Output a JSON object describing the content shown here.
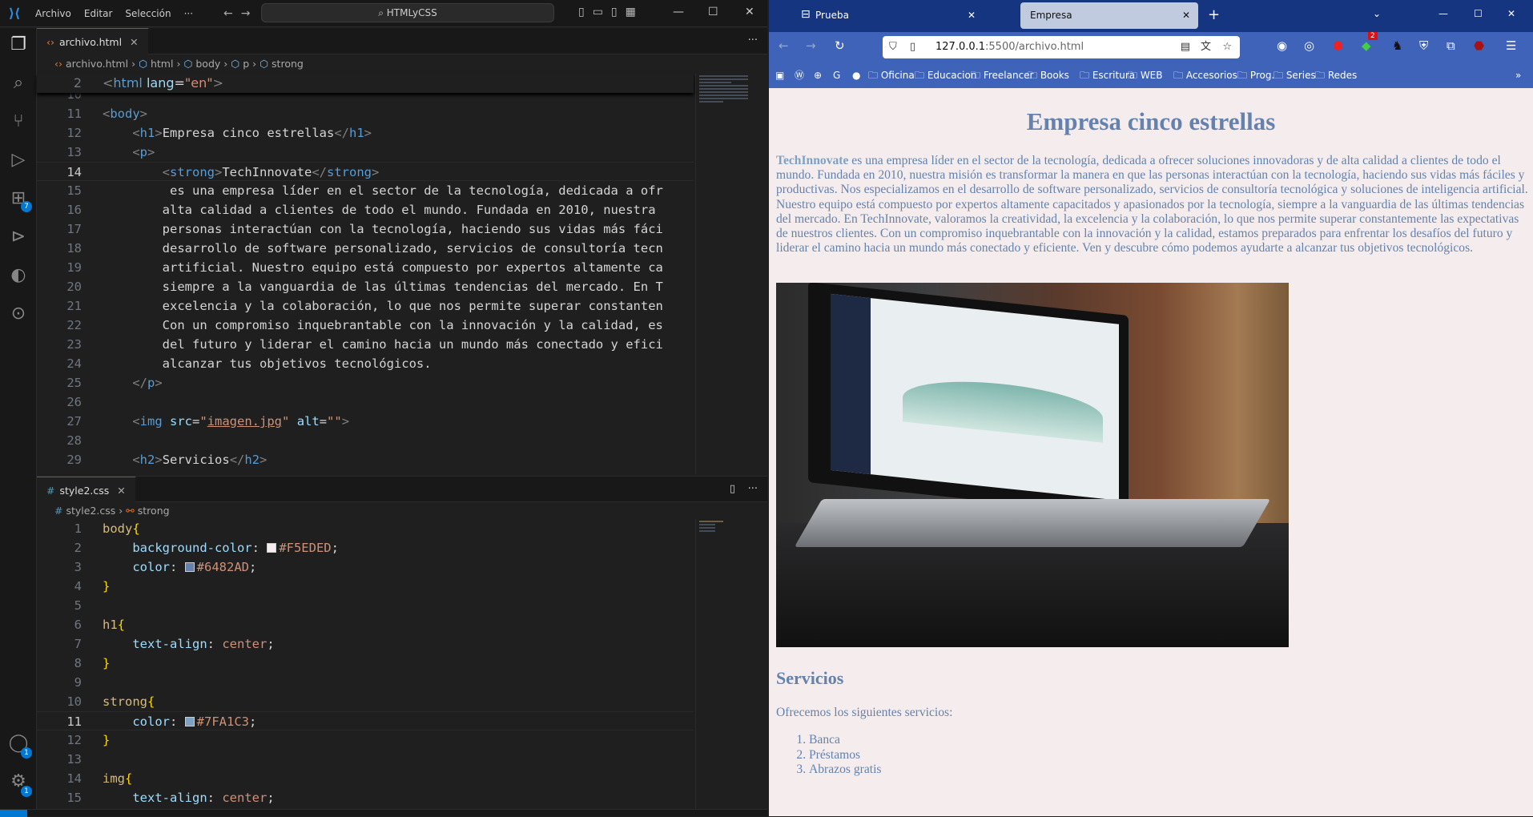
{
  "vscode": {
    "menu": [
      "Archivo",
      "Editar",
      "Selección",
      "···"
    ],
    "search": "HTMLyCSS",
    "activity_badges": {
      "extensions": "7",
      "accounts": "1",
      "settings": "1"
    },
    "html_editor": {
      "tab": "archivo.html",
      "breadcrumb": [
        "archivo.html",
        "html",
        "body",
        "p",
        "strong"
      ],
      "sticky": {
        "n": "2",
        "tokens": [
          [
            "tag",
            "<"
          ],
          [
            "tn",
            "html"
          ],
          [
            "at",
            " lang"
          ],
          [
            "pl",
            "="
          ],
          [
            "st",
            "\"en\""
          ],
          [
            "tag",
            ">"
          ]
        ]
      },
      "lines": [
        {
          "n": "10",
          "tokens": []
        },
        {
          "n": "11",
          "tokens": [
            [
              "tag",
              "<"
            ],
            [
              "tn",
              "body"
            ],
            [
              "tag",
              ">"
            ]
          ]
        },
        {
          "n": "12",
          "tokens": [
            [
              "pl",
              "    "
            ],
            [
              "tag",
              "<"
            ],
            [
              "tn",
              "h1"
            ],
            [
              "tag",
              ">"
            ],
            [
              "pl",
              "Empresa cinco estrellas"
            ],
            [
              "tag",
              "</"
            ],
            [
              "tn",
              "h1"
            ],
            [
              "tag",
              ">"
            ]
          ]
        },
        {
          "n": "13",
          "tokens": [
            [
              "pl",
              "    "
            ],
            [
              "tag",
              "<"
            ],
            [
              "tn",
              "p"
            ],
            [
              "tag",
              ">"
            ]
          ]
        },
        {
          "n": "14",
          "tokens": [
            [
              "pl",
              "        "
            ],
            [
              "tag",
              "<"
            ],
            [
              "tn",
              "strong"
            ],
            [
              "tag",
              ">"
            ],
            [
              "pl",
              "TechInnovate"
            ],
            [
              "tag",
              "</"
            ],
            [
              "tn",
              "strong"
            ],
            [
              "tag",
              ">"
            ]
          ]
        },
        {
          "n": "15",
          "tokens": [
            [
              "pl",
              "         es una empresa líder en el sector de la tecnología, dedicada a ofr"
            ]
          ]
        },
        {
          "n": "16",
          "tokens": [
            [
              "pl",
              "        alta calidad a clientes de todo el mundo. Fundada en 2010, nuestra"
            ]
          ]
        },
        {
          "n": "17",
          "tokens": [
            [
              "pl",
              "        personas interactúan con la tecnología, haciendo sus vidas más fáci"
            ]
          ]
        },
        {
          "n": "18",
          "tokens": [
            [
              "pl",
              "        desarrollo de software personalizado, servicios de consultoría tecn"
            ]
          ]
        },
        {
          "n": "19",
          "tokens": [
            [
              "pl",
              "        artificial. Nuestro equipo está compuesto por expertos altamente ca"
            ]
          ]
        },
        {
          "n": "20",
          "tokens": [
            [
              "pl",
              "        siempre a la vanguardia de las últimas tendencias del mercado. En T"
            ]
          ]
        },
        {
          "n": "21",
          "tokens": [
            [
              "pl",
              "        excelencia y la colaboración, lo que nos permite superar constanten"
            ]
          ]
        },
        {
          "n": "22",
          "tokens": [
            [
              "pl",
              "        Con un compromiso inquebrantable con la innovación y la calidad, es"
            ]
          ]
        },
        {
          "n": "23",
          "tokens": [
            [
              "pl",
              "        del futuro y liderar el camino hacia un mundo más conectado y efici"
            ]
          ]
        },
        {
          "n": "24",
          "tokens": [
            [
              "pl",
              "        alcanzar tus objetivos tecnológicos."
            ]
          ]
        },
        {
          "n": "25",
          "tokens": [
            [
              "pl",
              "    "
            ],
            [
              "tag",
              "</"
            ],
            [
              "tn",
              "p"
            ],
            [
              "tag",
              ">"
            ]
          ]
        },
        {
          "n": "26",
          "tokens": []
        },
        {
          "n": "27",
          "tokens": [
            [
              "pl",
              "    "
            ],
            [
              "tag",
              "<"
            ],
            [
              "tn",
              "img"
            ],
            [
              "at",
              " src"
            ],
            [
              "pl",
              "="
            ],
            [
              "st",
              "\""
            ],
            [
              "st lnk",
              "imagen.jpg"
            ],
            [
              "st",
              "\""
            ],
            [
              "at",
              " alt"
            ],
            [
              "pl",
              "="
            ],
            [
              "st",
              "\"\""
            ],
            [
              "tag",
              ">"
            ]
          ]
        },
        {
          "n": "28",
          "tokens": []
        },
        {
          "n": "29",
          "tokens": [
            [
              "pl",
              "    "
            ],
            [
              "tag",
              "<"
            ],
            [
              "tn",
              "h2"
            ],
            [
              "tag",
              ">"
            ],
            [
              "pl",
              "Servicios"
            ],
            [
              "tag",
              "</"
            ],
            [
              "tn",
              "h2"
            ],
            [
              "tag",
              ">"
            ]
          ]
        }
      ],
      "current_line": "14"
    },
    "css_editor": {
      "tab": "style2.css",
      "breadcrumb": [
        "style2.css",
        "strong"
      ],
      "lines": [
        {
          "n": "1",
          "tokens": [
            [
              "sel",
              "body"
            ],
            [
              "br",
              "{"
            ]
          ]
        },
        {
          "n": "2",
          "tokens": [
            [
              "pl",
              "    "
            ],
            [
              "pr",
              "background-color"
            ],
            [
              "pl",
              ": "
            ],
            [
              "sw",
              "#F5EDED"
            ],
            [
              "vl",
              "#F5EDED"
            ],
            [
              "pl",
              ";"
            ]
          ]
        },
        {
          "n": "3",
          "tokens": [
            [
              "pl",
              "    "
            ],
            [
              "pr",
              "color"
            ],
            [
              "pl",
              ": "
            ],
            [
              "sw",
              "#6482AD"
            ],
            [
              "vl",
              "#6482AD"
            ],
            [
              "pl",
              ";"
            ]
          ]
        },
        {
          "n": "4",
          "tokens": [
            [
              "br",
              "}"
            ]
          ]
        },
        {
          "n": "5",
          "tokens": []
        },
        {
          "n": "6",
          "tokens": [
            [
              "sel",
              "h1"
            ],
            [
              "br",
              "{"
            ]
          ]
        },
        {
          "n": "7",
          "tokens": [
            [
              "pl",
              "    "
            ],
            [
              "pr",
              "text-align"
            ],
            [
              "pl",
              ": "
            ],
            [
              "vl",
              "center"
            ],
            [
              "pl",
              ";"
            ]
          ]
        },
        {
          "n": "8",
          "tokens": [
            [
              "br",
              "}"
            ]
          ]
        },
        {
          "n": "9",
          "tokens": []
        },
        {
          "n": "10",
          "tokens": [
            [
              "sel",
              "strong"
            ],
            [
              "br",
              "{"
            ]
          ]
        },
        {
          "n": "11",
          "tokens": [
            [
              "pl",
              "    "
            ],
            [
              "pr",
              "color"
            ],
            [
              "pl",
              ": "
            ],
            [
              "sw",
              "#7FA1C3"
            ],
            [
              "vl",
              "#7FA1C3"
            ],
            [
              "pl",
              ";"
            ]
          ]
        },
        {
          "n": "12",
          "tokens": [
            [
              "br",
              "}"
            ]
          ]
        },
        {
          "n": "13",
          "tokens": []
        },
        {
          "n": "14",
          "tokens": [
            [
              "sel",
              "img"
            ],
            [
              "br",
              "{"
            ]
          ]
        },
        {
          "n": "15",
          "tokens": [
            [
              "pl",
              "    "
            ],
            [
              "pr",
              "text-align"
            ],
            [
              "pl",
              ": "
            ],
            [
              "vl",
              "center"
            ],
            [
              "pl",
              ";"
            ]
          ]
        }
      ],
      "current_line": "11"
    }
  },
  "browser": {
    "tabs": [
      {
        "label": "Prueba",
        "active": false
      },
      {
        "label": "Empresa",
        "active": true
      }
    ],
    "url_host": "127.0.0.1",
    "url_rest": ":5500/archivo.html",
    "extension_badge": "2",
    "bookmarks": [
      "Oficina",
      "Educacion",
      "Freelancer",
      "Books",
      "Escritura",
      "WEB",
      "Accesorios",
      "Prog.",
      "Series",
      "Redes"
    ],
    "page": {
      "h1": "Empresa cinco estrellas",
      "strong": "TechInnovate",
      "paragraph": " es una empresa líder en el sector de la tecnología, dedicada a ofrecer soluciones innovadoras y de alta calidad a clientes de todo el mundo. Fundada en 2010, nuestra misión es transformar la manera en que las personas interactúan con la tecnología, haciendo sus vidas más fáciles y productivas. Nos especializamos en el desarrollo de software personalizado, servicios de consultoría tecnológica y soluciones de inteligencia artificial. Nuestro equipo está compuesto por expertos altamente capacitados y apasionados por la tecnología, siempre a la vanguardia de las últimas tendencias del mercado. En TechInnovate, valoramos la creatividad, la excelencia y la colaboración, lo que nos permite superar constantemente las expectativas de nuestros clientes. Con un compromiso inquebrantable con la innovación y la calidad, estamos preparados para enfrentar los desafíos del futuro y liderar el camino hacia un mundo más conectado y eficiente. Ven y descubre cómo podemos ayudarte a alcanzar tus objetivos tecnológicos.",
      "h2": "Servicios",
      "services_intro": "Ofrecemos los siguientes servicios:",
      "services": [
        "Banca",
        "Préstamos",
        "Abrazos gratis"
      ]
    },
    "colors": {
      "page_bg": "#F5EDED",
      "text": "#6482AD",
      "strong": "#7FA1C3"
    }
  }
}
